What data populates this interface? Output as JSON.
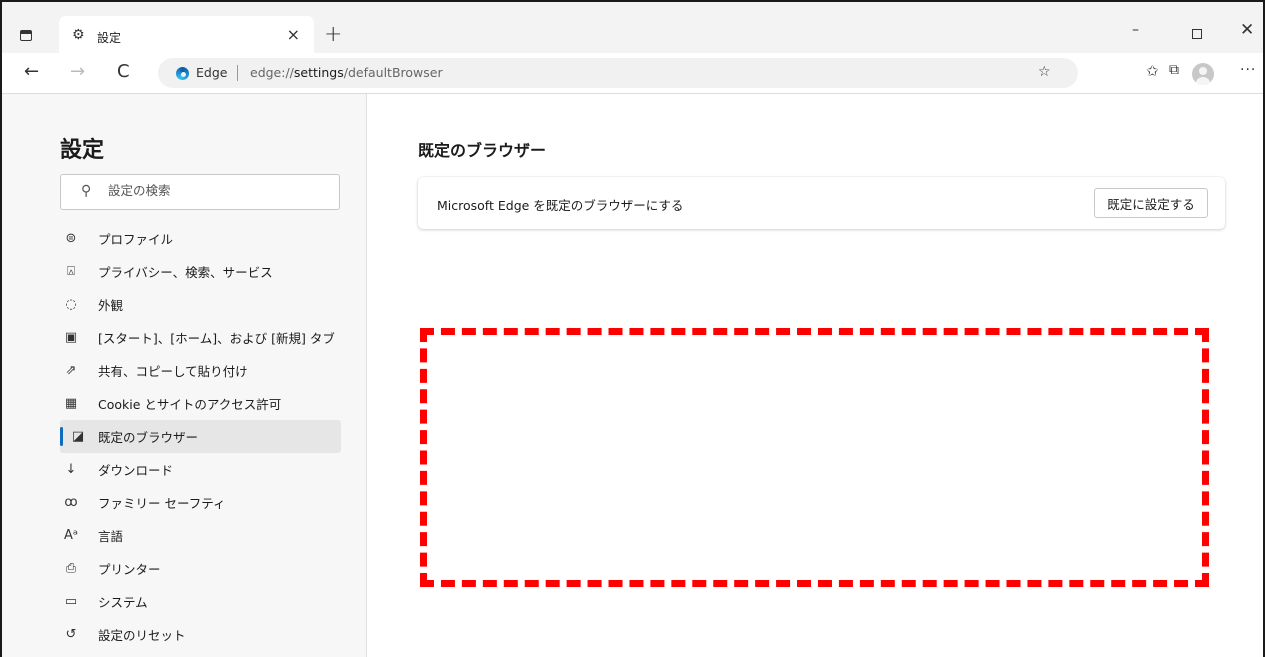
{
  "browser": {
    "tab_title": "設定",
    "tab_close": "×",
    "new_tab": "+",
    "window_min": "–",
    "window_close": "✕"
  },
  "toolbar": {
    "back": "←",
    "forward": "→",
    "refresh": "C",
    "address_label": "Edge",
    "address_url_prefix": "edge://",
    "address_url_bold": "settings",
    "address_url_suffix": "/defaultBrowser",
    "more": "···"
  },
  "sidebar": {
    "title": "設定",
    "search_placeholder": "設定の検索",
    "items": [
      {
        "label": "プロファイル",
        "icon": "profile-icon",
        "glyph": "⊜"
      },
      {
        "label": "プライバシー、検索、サービス",
        "icon": "lock-icon",
        "glyph": "🔒︎"
      },
      {
        "label": "外観",
        "icon": "palette-icon",
        "glyph": "◌"
      },
      {
        "label": "[スタート]、[ホーム]、および [新規] タブ",
        "icon": "home-tab-icon",
        "glyph": "▣"
      },
      {
        "label": "共有、コピーして貼り付け",
        "icon": "share-icon",
        "glyph": "⇗"
      },
      {
        "label": "Cookie とサイトのアクセス許可",
        "icon": "site-permissions-icon",
        "glyph": "▦"
      },
      {
        "label": "既定のブラウザー",
        "icon": "default-browser-icon",
        "glyph": "◪",
        "active": true
      },
      {
        "label": "ダウンロード",
        "icon": "download-icon",
        "glyph": "↓"
      },
      {
        "label": "ファミリー セーフティ",
        "icon": "family-icon",
        "glyph": "ꝏ"
      },
      {
        "label": "言語",
        "icon": "language-icon",
        "glyph": "Aᵃ"
      },
      {
        "label": "プリンター",
        "icon": "printer-icon",
        "glyph": "⎙"
      },
      {
        "label": "システム",
        "icon": "system-icon",
        "glyph": "▭"
      },
      {
        "label": "設定のリセット",
        "icon": "reset-icon",
        "glyph": "↺"
      }
    ]
  },
  "main": {
    "title": "既定のブラウザー",
    "card_text": "Microsoft Edge を既定のブラウザーにする",
    "card_button": "既定に設定する"
  },
  "colors": {
    "accent": "#0f6cbd",
    "highlight": "#ff0000"
  }
}
